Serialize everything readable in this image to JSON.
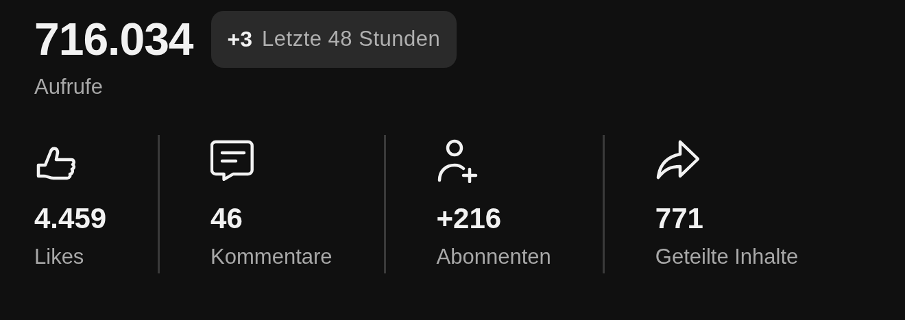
{
  "views": {
    "value": "716.034",
    "label": "Aufrufe"
  },
  "recent": {
    "delta": "+3",
    "period": "Letzte 48 Stunden"
  },
  "stats": [
    {
      "kind": "likes",
      "value": "4.459",
      "label": "Likes"
    },
    {
      "kind": "comments",
      "value": "46",
      "label": "Kommentare"
    },
    {
      "kind": "subscribers",
      "value": "+216",
      "label": "Abonnenten"
    },
    {
      "kind": "shares",
      "value": "771",
      "label": "Geteilte Inhalte"
    }
  ]
}
